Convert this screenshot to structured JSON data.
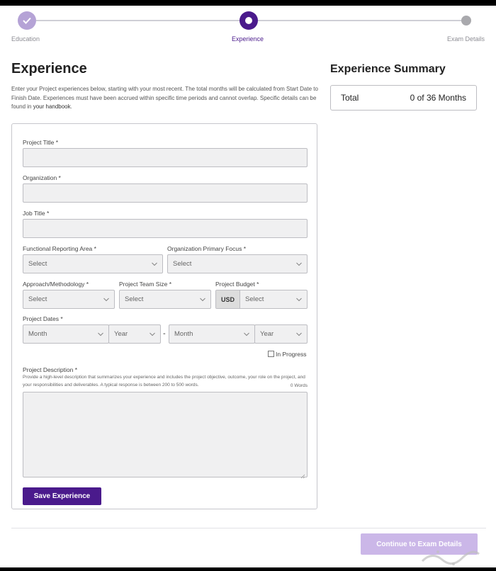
{
  "stepper": {
    "steps": [
      {
        "label": "Education",
        "state": "done"
      },
      {
        "label": "Experience",
        "state": "current"
      },
      {
        "label": "Exam Details",
        "state": "upcoming"
      }
    ]
  },
  "page": {
    "title": "Experience",
    "intro_text": "Enter your Project experiences below, starting with your most recent. The total months will be calculated from Start Date to Finish Date. Experiences must have been accrued within specific time periods and cannot overlap. Specific details can be found in",
    "intro_link": "your handbook",
    "intro_end": "."
  },
  "summary": {
    "title": "Experience Summary",
    "total_label": "Total",
    "total_value": "0 of 36 Months"
  },
  "form": {
    "project_title_label": "Project Title *",
    "organization_label": "Organization *",
    "job_title_label": "Job Title *",
    "functional_area_label": "Functional Reporting Area *",
    "functional_area_value": "Select",
    "org_focus_label": "Organization Primary Focus *",
    "org_focus_value": "Select",
    "approach_label": "Approach/Methodology *",
    "approach_value": "Select",
    "team_size_label": "Project Team Size *",
    "team_size_value": "Select",
    "budget_label": "Project Budget *",
    "budget_currency": "USD",
    "budget_value": "Select",
    "dates_label": "Project Dates *",
    "start_month": "Month",
    "start_year": "Year",
    "date_separator": "-",
    "end_month": "Month",
    "end_year": "Year",
    "in_progress_label": "In Progress",
    "in_progress_checked": false,
    "description_label": "Project Description *",
    "description_help": "Provide a high-level description that summarizes your experience and includes the project objective, outcome, your role on the project, and your responsibilities and deliverables. A typical response is between 200 to 500 words.",
    "word_count": "0 Words",
    "save_button": "Save Experience"
  },
  "footer": {
    "continue_button": "Continue to Exam Details"
  },
  "colors": {
    "primary": "#4a1a8c",
    "primary_light": "#b5a3d6",
    "disabled_button": "#cbb7e8"
  }
}
